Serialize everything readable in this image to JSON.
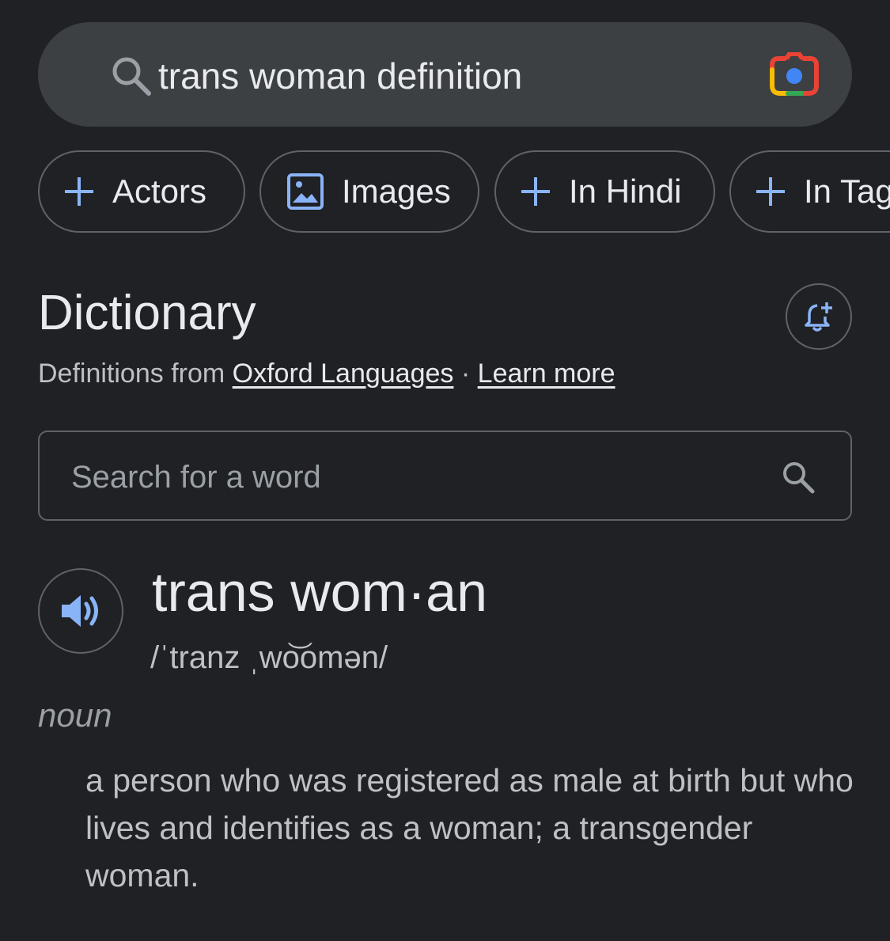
{
  "search": {
    "query": "trans woman definition"
  },
  "chips": [
    {
      "label": "Actors",
      "icon": "plus-icon"
    },
    {
      "label": "Images",
      "icon": "image-icon"
    },
    {
      "label": "In Hindi",
      "icon": "plus-icon"
    },
    {
      "label": "In Tag",
      "icon": "plus-icon"
    }
  ],
  "dictionary": {
    "title": "Dictionary",
    "source_prefix": "Definitions from",
    "source_link": "Oxford Languages",
    "separator": "·",
    "learn_more": "Learn more",
    "search_placeholder": "Search for a word"
  },
  "entry": {
    "headword": "trans wom·an",
    "phonetic": "/ˈtranz ˌwo͝omən/",
    "part_of_speech": "noun",
    "definition": "a person who was registered as male at birth but who lives and identifies as a woman; a transgender woman."
  },
  "colors": {
    "background": "#202124",
    "searchbar": "#3c4043",
    "accent_blue": "#8ab4f8",
    "border": "#5f6368"
  }
}
